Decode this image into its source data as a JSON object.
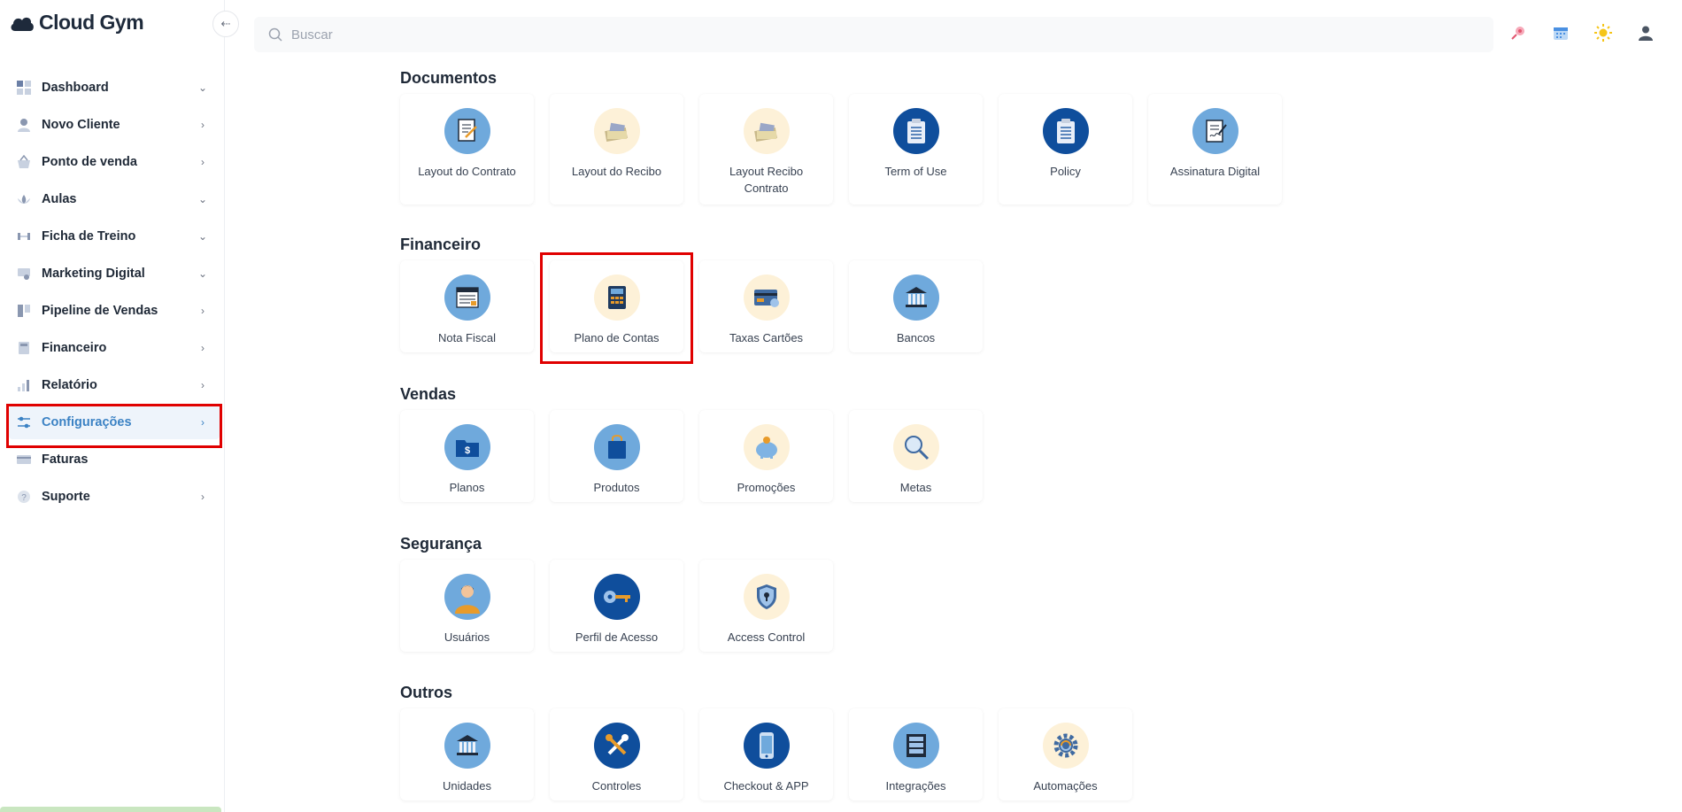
{
  "app": {
    "logo_text": "Cloud Gym",
    "brand_color": "#1e2a3b",
    "accent_color": "#3b82c4",
    "highlight_color": "#e00000"
  },
  "search": {
    "placeholder": "Buscar"
  },
  "sidebar": {
    "items": [
      {
        "label": "Dashboard",
        "icon": "grid-icon",
        "chevron": "chevron-down-icon"
      },
      {
        "label": "Novo Cliente",
        "icon": "user-icon",
        "chevron": "chevron-right-icon"
      },
      {
        "label": "Ponto de venda",
        "icon": "basket-icon",
        "chevron": "chevron-right-icon"
      },
      {
        "label": "Aulas",
        "icon": "lotus-icon",
        "chevron": "chevron-down-icon"
      },
      {
        "label": "Ficha de Treino",
        "icon": "dumbbell-icon",
        "chevron": "chevron-down-icon"
      },
      {
        "label": "Marketing Digital",
        "icon": "megaphone-icon",
        "chevron": "chevron-down-icon"
      },
      {
        "label": "Pipeline de Vendas",
        "icon": "pipeline-icon",
        "chevron": "chevron-right-icon"
      },
      {
        "label": "Financeiro",
        "icon": "calculator-icon",
        "chevron": "chevron-right-icon"
      },
      {
        "label": "Relatório",
        "icon": "bar-chart-icon",
        "chevron": "chevron-right-icon"
      },
      {
        "label": "Configurações",
        "icon": "sliders-icon",
        "chevron": "chevron-right-icon",
        "active": true
      },
      {
        "label": "Faturas",
        "icon": "credit-card-icon",
        "chevron": ""
      },
      {
        "label": "Suporte",
        "icon": "help-icon",
        "chevron": "chevron-right-icon"
      }
    ]
  },
  "top_icons": [
    "pin-icon",
    "calendar-icon",
    "sun-icon",
    "user-profile-icon"
  ],
  "sections": {
    "documentos": {
      "title": "Documentos",
      "cards": [
        {
          "label": "Layout do Contrato",
          "icon": "contract-icon"
        },
        {
          "label": "Layout do Recibo",
          "icon": "receipt-money-icon"
        },
        {
          "label": "Layout Recibo Contrato",
          "icon": "receipt-money-icon"
        },
        {
          "label": "Term of Use",
          "icon": "clipboard-icon"
        },
        {
          "label": "Policy",
          "icon": "clipboard-icon"
        },
        {
          "label": "Assinatura Digital",
          "icon": "signature-icon"
        }
      ]
    },
    "financeiro": {
      "title": "Financeiro",
      "cards": [
        {
          "label": "Nota Fiscal",
          "icon": "invoice-icon"
        },
        {
          "label": "Plano de Contas",
          "icon": "calculator-icon"
        },
        {
          "label": "Taxas Cartões",
          "icon": "credit-card-icon"
        },
        {
          "label": "Bancos",
          "icon": "bank-icon"
        }
      ]
    },
    "vendas": {
      "title": "Vendas",
      "cards": [
        {
          "label": "Planos",
          "icon": "folder-dollar-icon"
        },
        {
          "label": "Produtos",
          "icon": "shopping-bag-icon"
        },
        {
          "label": "Promoções",
          "icon": "piggy-bank-icon"
        },
        {
          "label": "Metas",
          "icon": "magnifier-icon"
        }
      ]
    },
    "seguranca": {
      "title": "Segurança",
      "cards": [
        {
          "label": "Usuários",
          "icon": "person-icon"
        },
        {
          "label": "Perfil de Acesso",
          "icon": "key-icon"
        },
        {
          "label": "Access Control",
          "icon": "shield-lock-icon"
        }
      ]
    },
    "outros": {
      "title": "Outros",
      "cards": [
        {
          "label": "Unidades",
          "icon": "bank-icon"
        },
        {
          "label": "Controles",
          "icon": "tools-icon"
        },
        {
          "label": "Checkout & APP",
          "icon": "smartphone-icon"
        },
        {
          "label": "Integrações",
          "icon": "server-icon"
        },
        {
          "label": "Automações",
          "icon": "gear-cycle-icon"
        }
      ]
    }
  }
}
